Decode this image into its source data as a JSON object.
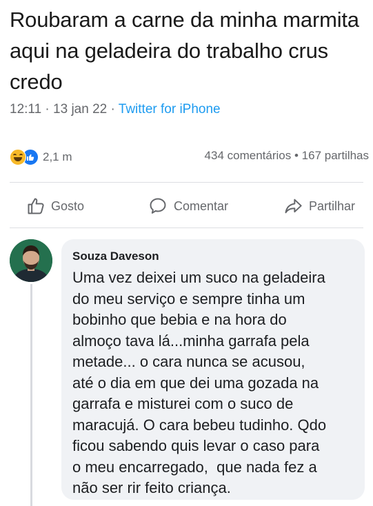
{
  "post": {
    "text": "Roubaram a carne da minha marmita aqui na geladeira do trabalho crus credo",
    "time": "12:11",
    "date": "13 jan 22",
    "separator": "·",
    "source": "Twitter for iPhone"
  },
  "reactions": {
    "icons": [
      "haha-emoji-icon",
      "like-emoji-icon"
    ],
    "count": "2,1 m"
  },
  "stats": {
    "comments": "434 comentários",
    "dot": "•",
    "shares": "167 partilhas"
  },
  "actions": {
    "like": {
      "label": "Gosto",
      "icon": "thumbs-up-icon"
    },
    "comment": {
      "label": "Comentar",
      "icon": "speech-bubble-icon"
    },
    "share": {
      "label": "Partilhar",
      "icon": "share-arrow-icon"
    }
  },
  "comment": {
    "author": "Souza Daveson",
    "lines": [
      "Uma vez deixei um suco na geladeira",
      "do meu serviço e sempre tinha um",
      "bobinho que bebia e na hora do",
      "almoço tava lá...minha garrafa pela",
      "metade... o cara nunca se acusou,",
      "até o dia em que dei uma gozada na",
      "garrafa e misturei com o suco de",
      "maracujá. O cara bebeu tudinho. Qdo",
      "ficou sabendo quis levar o caso para",
      "o meu encarregado,  que nada fez a",
      "não ser rir feito criança."
    ]
  },
  "colors": {
    "muted": "#65676b",
    "link": "#1d9bf0",
    "bubble": "#f0f2f5",
    "like_blue": "#1877f2",
    "haha_yellow": "#f7b928"
  }
}
